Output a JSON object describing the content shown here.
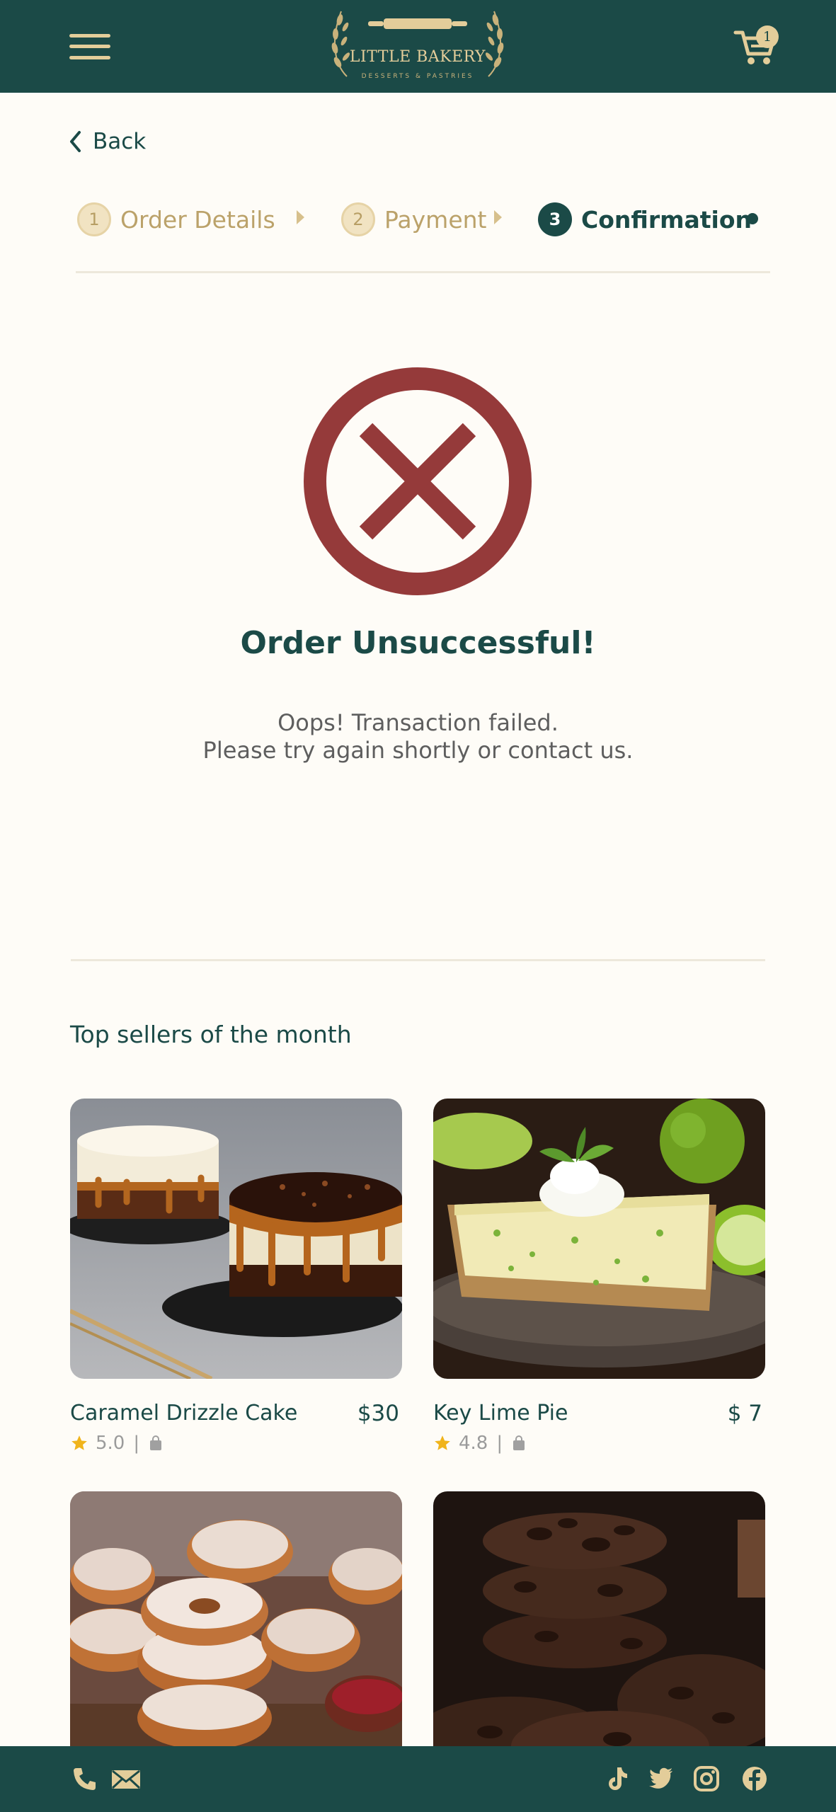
{
  "header": {
    "logo_title": "LITTLE BAKERY",
    "logo_subtitle": "DESSERTS & PASTRIES",
    "cart_count": "1",
    "menu_icon": "hamburger-menu-icon",
    "cart_icon": "shopping-cart-icon"
  },
  "nav": {
    "back_label": "Back"
  },
  "steps": [
    {
      "number": "1",
      "label": "Order Details",
      "state": "done"
    },
    {
      "number": "2",
      "label": "Payment",
      "state": "done"
    },
    {
      "number": "3",
      "label": "Confirmation",
      "state": "active"
    }
  ],
  "status": {
    "icon": "error-x-circle-icon",
    "title": "Order Unsuccessful!",
    "message_line1": "Oops! Transaction failed.",
    "message_line2": "Please try again shortly or contact us."
  },
  "top_sellers": {
    "title": "Top sellers of the month",
    "products": [
      {
        "name": "Caramel Drizzle Cake",
        "price": "$30",
        "rating": "5.0"
      },
      {
        "name": "Key Lime Pie",
        "price": "$ 7",
        "rating": "4.8"
      },
      {
        "name": "",
        "price": "",
        "rating": ""
      },
      {
        "name": "",
        "price": "",
        "rating": ""
      }
    ]
  },
  "footer": {
    "icons": [
      "phone-icon",
      "mail-icon",
      "tiktok-icon",
      "twitter-icon",
      "instagram-icon",
      "facebook-icon"
    ]
  },
  "colors": {
    "primary": "#1B4A47",
    "accent_gold": "#E3CD9A",
    "error_red": "#953A3A",
    "background": "#FEFCF7",
    "star": "#F0B41C"
  }
}
